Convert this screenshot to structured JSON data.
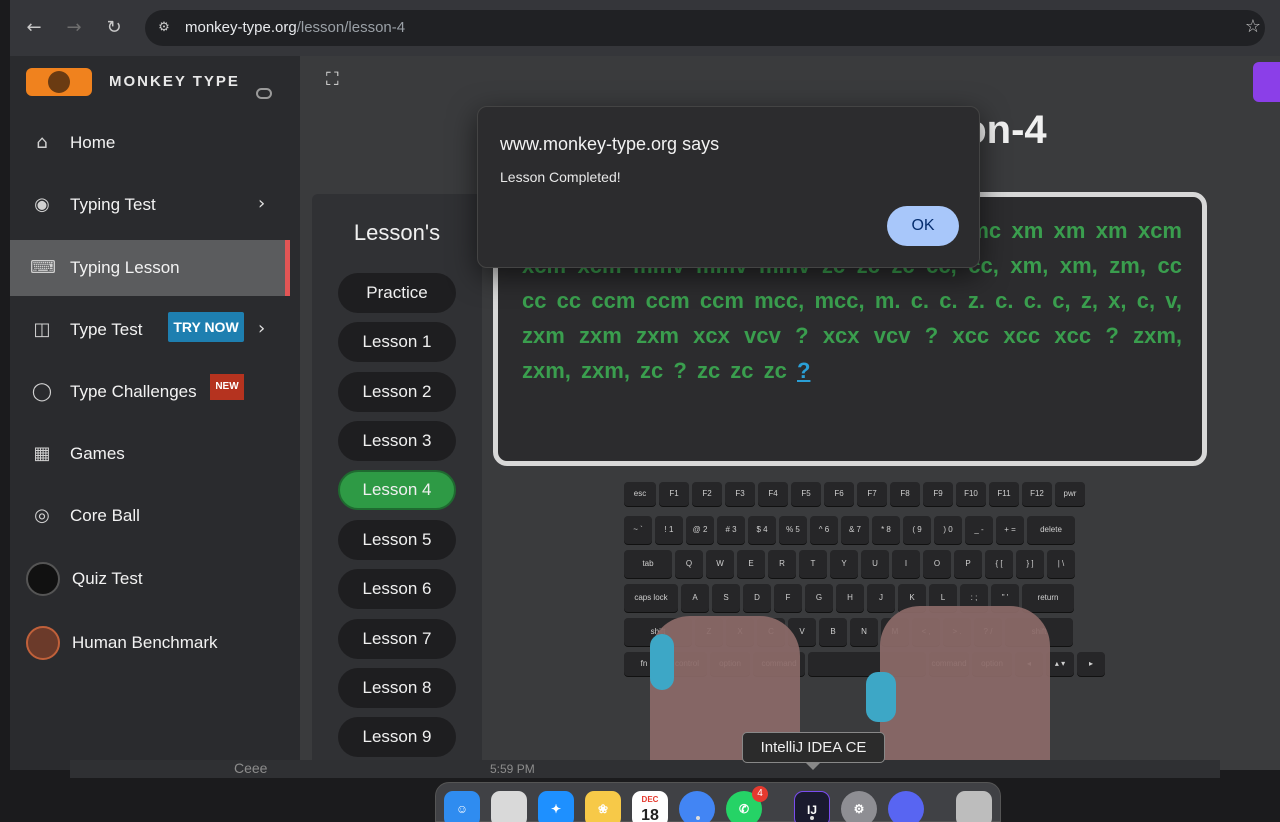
{
  "browser": {
    "url_host": "monkey-type.org",
    "url_path": "/lesson/lesson-4",
    "back_icon": "arrow-left-icon",
    "forward_icon": "arrow-right-icon",
    "reload_icon": "reload-icon",
    "bookmark_icon": "star-icon"
  },
  "brand": {
    "name": "MONKEY TYPE"
  },
  "sidebar": {
    "items": [
      {
        "label": "Home",
        "icon": "home-icon"
      },
      {
        "label": "Typing Test",
        "icon": "github-icon"
      },
      {
        "label": "Typing Lesson",
        "icon": "keyboard-icon",
        "active": true
      },
      {
        "label": "Type Test",
        "icon": "cat-icon",
        "badge": "TRY NOW"
      },
      {
        "label": "Type Challenges",
        "icon": "award-icon",
        "badge": "NEW"
      },
      {
        "label": "Games",
        "icon": "grid-icon"
      },
      {
        "label": "Core Ball",
        "icon": "target-icon"
      },
      {
        "label": "Quiz Test",
        "icon": "avatar-icon"
      },
      {
        "label": "Human Benchmark",
        "icon": "benchmark-icon"
      }
    ]
  },
  "page": {
    "heading": "son-4"
  },
  "lessons": {
    "title": "Lesson's",
    "items": [
      "Practice",
      "Lesson 1",
      "Lesson 2",
      "Lesson 3",
      "Lesson 4",
      "Lesson 5",
      "Lesson 6",
      "Lesson 7",
      "Lesson 8",
      "Lesson 9"
    ],
    "active": "Lesson 4"
  },
  "typing": {
    "text": "cvv cvv cvv mcc mcc mcc mmc mmc mmc xm xm xm xcm xcm xcm mmv mmv mmv zc zc zc cc, cc, xm, xm, zm, cc cc cc ccm ccm ccm mcc, mcc, m. c. c. z. c. c. c, z, x, c, v, zxm zxm zxm xcx vcv ? xcx vcv ? xcc xcc xcc ? zxm, zxm, zxm, zc ? zc zc zc",
    "cursor_char": "?"
  },
  "keyboard": {
    "row1": [
      "esc",
      "F1",
      "F2",
      "F3",
      "F4",
      "F5",
      "F6",
      "F7",
      "F8",
      "F9",
      "F10",
      "F11",
      "F12",
      "pwr"
    ],
    "row2": [
      "~ `",
      "! 1",
      "@ 2",
      "# 3",
      "$ 4",
      "% 5",
      "^ 6",
      "& 7",
      "* 8",
      "( 9",
      ") 0",
      "_ -",
      "+ =",
      "delete"
    ],
    "row3": [
      "tab",
      "Q",
      "W",
      "E",
      "R",
      "T",
      "Y",
      "U",
      "I",
      "O",
      "P",
      "{ [",
      "} ]",
      "| \\"
    ],
    "row4": [
      "caps lock",
      "A",
      "S",
      "D",
      "F",
      "G",
      "H",
      "J",
      "K",
      "L",
      ": ;",
      "\" '",
      "return"
    ],
    "row5": [
      "shift",
      "Z",
      "X",
      "C",
      "V",
      "B",
      "N",
      "M",
      "< ,",
      "> .",
      "? /",
      "shift"
    ],
    "row6": [
      "fn",
      "control",
      "option",
      "command",
      "",
      "command",
      "option",
      "◂",
      "▴ ▾",
      "▸"
    ]
  },
  "dialog": {
    "title": "www.monkey-type.org says",
    "message": "Lesson Completed!",
    "ok_label": "OK"
  },
  "dock": {
    "tooltip": "IntelliJ IDEA CE",
    "calendar_month": "DEC",
    "calendar_day": "18",
    "whatsapp_badge": "4",
    "intellij_label": "IJ",
    "colors": {
      "finder": "#2f8cf0",
      "launchpad": "#d9d9d9",
      "safari": "#1e90ff",
      "photos": "#f7c948",
      "calendar": "#ffffff",
      "chrome": "#4285f4",
      "whatsapp": "#25d366",
      "intellij": "#1a1a2e",
      "settings": "#8e8e93",
      "discord": "#5865f2",
      "trash": "#bdbdbd"
    }
  },
  "background": {
    "name": "Ceee",
    "time": "5:59 PM"
  },
  "theme": {
    "accent": "#2e9a45",
    "active_nav": "#e25555",
    "dialog_ok": "#a8c7fa"
  }
}
